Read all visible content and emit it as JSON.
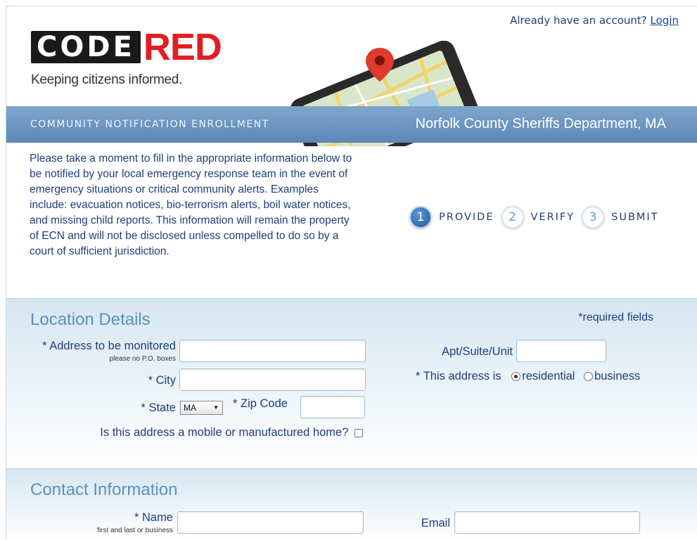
{
  "header": {
    "account_prompt": "Already have an account?",
    "login_link": "Login",
    "logo_part1": "CODE",
    "logo_part2": "RED",
    "tagline": "Keeping citizens informed.",
    "banner_left": "COMMUNITY NOTIFICATION ENROLLMENT",
    "banner_right": "Norfolk County Sheriffs Department, MA"
  },
  "intro": "Please take a moment to fill in the appropriate information below to be notified by your local emergency response team in the event of emergency situations or critical community alerts. Examples include: evacuation notices, bio-terrorism alerts, boil water notices, and missing child reports. This information will remain the property of ECN and will not be disclosed unless compelled to do so by a court of sufficient jurisdiction.",
  "steps": [
    {
      "num": "1",
      "label": "PROVIDE",
      "active": true
    },
    {
      "num": "2",
      "label": "VERIFY",
      "active": false
    },
    {
      "num": "3",
      "label": "SUBMIT",
      "active": false
    }
  ],
  "location": {
    "title": "Location Details",
    "required_note": "*required fields",
    "address_label": "* Address to be monitored",
    "address_hint": "please no P.O. boxes",
    "address_value": "",
    "city_label": "* City",
    "city_value": "",
    "state_label": "* State",
    "state_value": "MA",
    "zip_label": "* Zip Code",
    "zip_value": "",
    "apt_label": "Apt/Suite/Unit",
    "apt_value": "",
    "address_type_label": "* This address is",
    "type_residential": "residential",
    "type_business": "business",
    "type_selected": "residential",
    "mobile_home_label": "Is this address a mobile or manufactured home?",
    "mobile_home_checked": false
  },
  "contact": {
    "title": "Contact Information",
    "name_label": "* Name",
    "name_hint": "first and last or business",
    "name_value": "",
    "email_label": "Email",
    "email_value": ""
  },
  "colors": {
    "banner": "#6b95c2",
    "accent_red": "#e21d24",
    "section_title": "#5a91bf",
    "text": "#1f3d7a"
  }
}
